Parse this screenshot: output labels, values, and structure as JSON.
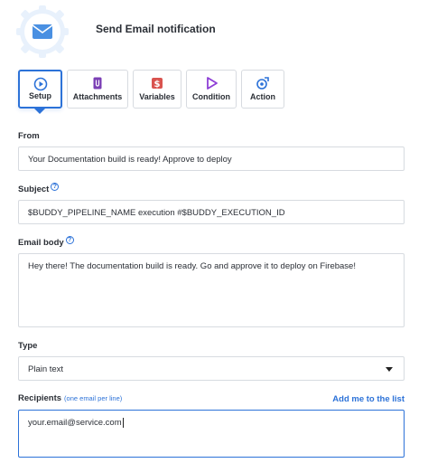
{
  "header": {
    "title": "Send Email notification"
  },
  "tabs": [
    {
      "label": "Setup",
      "icon": "play-circle-icon",
      "active": true
    },
    {
      "label": "Attachments",
      "icon": "attachment-icon",
      "active": false
    },
    {
      "label": "Variables",
      "icon": "dollar-icon",
      "active": false
    },
    {
      "label": "Condition",
      "icon": "triangle-play-icon",
      "active": false
    },
    {
      "label": "Action",
      "icon": "action-icon",
      "active": false
    }
  ],
  "form": {
    "from_label": "From",
    "from_value": "Your Documentation build is ready! Approve to deploy",
    "subject_label": "Subject",
    "subject_value": "$BUDDY_PIPELINE_NAME execution #$BUDDY_EXECUTION_ID",
    "body_label": "Email body",
    "body_value": "Hey there! The documentation build is ready. Go and approve it to deploy on Firebase!",
    "type_label": "Type",
    "type_value": "Plain text",
    "recipients_label": "Recipients",
    "recipients_hint": "(one email per line)",
    "add_me_link": "Add me to the list",
    "recipients_value": "your.email@service.com"
  },
  "colors": {
    "accent": "#2c72d8",
    "border": "#d7dbe0",
    "attachments_icon": "#7b3fb5",
    "variables_icon": "#d9534f",
    "condition_icon": "#8e3fd6"
  }
}
